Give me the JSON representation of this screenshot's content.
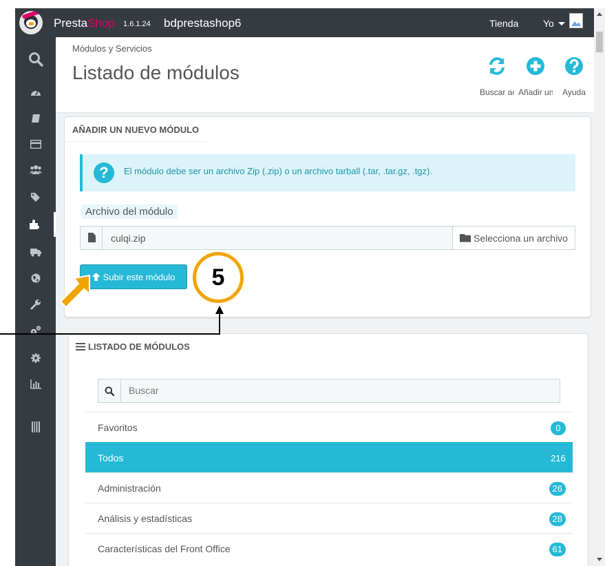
{
  "app": {
    "brand_part1": "Presta",
    "brand_part2": "Shop",
    "version": "1.6.1.24",
    "shop_name": "bdprestashop6",
    "header_links": {
      "store": "Tienda",
      "user": "Yo"
    }
  },
  "sidebar": {
    "items": [
      {
        "icon": "search-icon"
      },
      {
        "icon": "dashboard-icon"
      },
      {
        "icon": "catalog-icon"
      },
      {
        "icon": "orders-icon"
      },
      {
        "icon": "customers-icon"
      },
      {
        "icon": "price-rules-icon"
      },
      {
        "icon": "modules-icon",
        "active": true
      },
      {
        "icon": "shipping-icon"
      },
      {
        "icon": "localization-icon"
      },
      {
        "icon": "preferences-icon"
      },
      {
        "icon": "advanced-parameters-icon"
      },
      {
        "icon": "administration-icon"
      },
      {
        "icon": "stats-icon"
      },
      {
        "icon": "barcode-icon"
      }
    ]
  },
  "page": {
    "breadcrumb": "Módulos y Servicios",
    "title": "Listado de módulos",
    "toolbar": [
      {
        "icon": "refresh-icon",
        "label": "Buscar actualizaciones"
      },
      {
        "icon": "add-circle-icon",
        "label": "Añadir un nuevo módulo"
      },
      {
        "icon": "help-icon",
        "label": "Ayuda"
      }
    ]
  },
  "upload_panel": {
    "heading": "AÑADIR UN NUEVO MÓDULO",
    "info_text": "El módulo debe ser un archivo Zip (.zip) o un archivo tarball (.tar, .tar.gz, .tgz).",
    "file_label": "Archivo del módulo",
    "file_value": "culqi.zip",
    "choose_file_label": "Selecciona un archivo",
    "submit_label": "Subir este módulo"
  },
  "modules_list": {
    "heading": "LISTADO DE MÓDULOS",
    "search_placeholder": "Buscar",
    "categories": [
      {
        "name": "Favoritos",
        "count": "0"
      },
      {
        "name": "Todos",
        "count": "216",
        "active": true
      },
      {
        "name": "Administración",
        "count": "26"
      },
      {
        "name": "Análisis y estadísticas",
        "count": "28"
      },
      {
        "name": "Características del Front Office",
        "count": "61"
      }
    ]
  },
  "annotation": {
    "step_number": "5"
  },
  "colors": {
    "accent": "#25b9d7",
    "sidebar_bg": "#363a41",
    "brand_pink": "#df0067",
    "annotation": "#f0a500"
  }
}
